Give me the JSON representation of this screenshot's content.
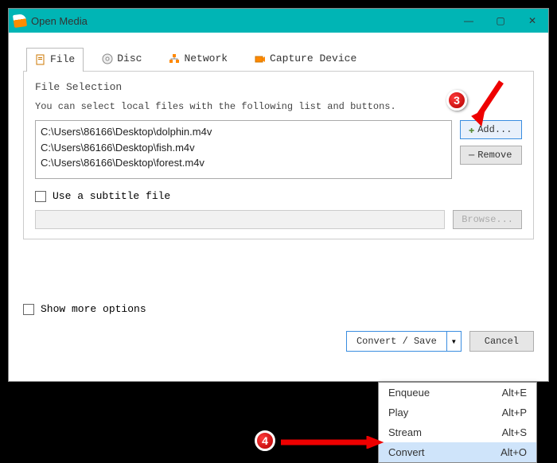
{
  "titlebar": {
    "title": "Open Media"
  },
  "tabs": {
    "file": "File",
    "disc": "Disc",
    "network": "Network",
    "capture": "Capture Device"
  },
  "fileSelection": {
    "legend": "File Selection",
    "hint": "You can select local files with the following list and buttons.",
    "files": [
      "C:\\Users\\86166\\Desktop\\dolphin.m4v",
      "C:\\Users\\86166\\Desktop\\fish.m4v",
      "C:\\Users\\86166\\Desktop\\forest.m4v"
    ],
    "addLabel": "Add...",
    "removeLabel": "Remove"
  },
  "subtitle": {
    "label": "Use a subtitle file",
    "browse": "Browse..."
  },
  "moreOptions": {
    "label": "Show more options"
  },
  "footer": {
    "convertSave": "Convert / Save",
    "cancel": "Cancel"
  },
  "menu": {
    "items": [
      {
        "label": "Enqueue",
        "shortcut": "Alt+E"
      },
      {
        "label": "Play",
        "shortcut": "Alt+P"
      },
      {
        "label": "Stream",
        "shortcut": "Alt+S"
      },
      {
        "label": "Convert",
        "shortcut": "Alt+O"
      }
    ]
  },
  "callouts": {
    "c3": "3",
    "c4": "4"
  }
}
